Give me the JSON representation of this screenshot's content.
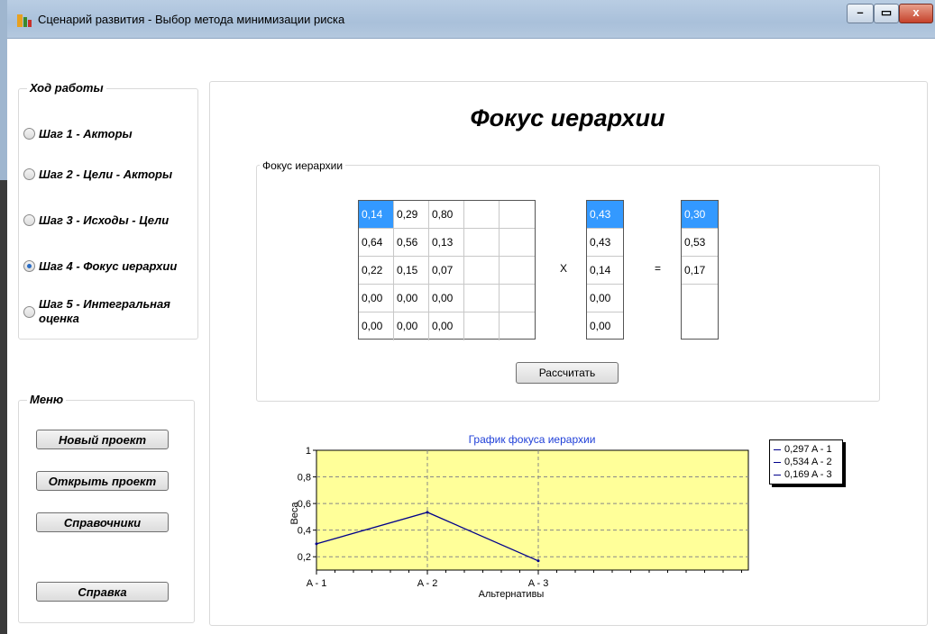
{
  "window": {
    "title": "Сценарий развития - Выбор метода минимизации риска",
    "controls": {
      "minimize": "–",
      "maximize": "▭",
      "close": "x"
    }
  },
  "workflow": {
    "title": "Ход работы",
    "steps": [
      {
        "label": "Шаг 1 - Акторы",
        "checked": false
      },
      {
        "label": "Шаг 2 - Цели - Акторы",
        "checked": false
      },
      {
        "label": "Шаг 3 - Исходы - Цели",
        "checked": false
      },
      {
        "label": "Шаг 4 - Фокус иерархии",
        "checked": true
      },
      {
        "label": "Шаг 5 - Интегральная",
        "label2": "оценка",
        "checked": false
      }
    ]
  },
  "menu": {
    "title": "Меню",
    "buttons": [
      "Новый проект",
      "Открыть проект",
      "Справочники",
      "Справка"
    ]
  },
  "main": {
    "heading": "Фокус иерархии",
    "group_label": "Фокус иерархии",
    "matrix": [
      [
        "0,14",
        "0,29",
        "0,80",
        "",
        ""
      ],
      [
        "0,64",
        "0,56",
        "0,13",
        "",
        ""
      ],
      [
        "0,22",
        "0,15",
        "0,07",
        "",
        ""
      ],
      [
        "0,00",
        "0,00",
        "0,00",
        "",
        ""
      ],
      [
        "0,00",
        "0,00",
        "0,00",
        "",
        ""
      ]
    ],
    "vector": [
      "0,43",
      "0,43",
      "0,14",
      "0,00",
      "0,00"
    ],
    "result": [
      "0,30",
      "0,53",
      "0,17",
      ""
    ],
    "multiply_sign": "X",
    "equals_sign": "=",
    "calc_button": "Рассчитать"
  },
  "chart_data": {
    "type": "line",
    "title": "График фокуса иерархии",
    "xlabel": "Альтернативы",
    "ylabel": "Веса",
    "categories": [
      "A - 1",
      "A - 2",
      "A - 3"
    ],
    "series": [
      {
        "name": "",
        "values": [
          0.297,
          0.534,
          0.169
        ]
      }
    ],
    "legend": [
      "0,297 A - 1",
      "0,534 A - 2",
      "0,169 A - 3"
    ],
    "yticks": [
      "1",
      "0,8",
      "0,6",
      "0,4",
      "0,2"
    ],
    "ylim": [
      0.1,
      1
    ],
    "grid": true,
    "legend_position": "right",
    "colors": {
      "plot_bg": "#ffff99",
      "line": "#00008b",
      "title": "#1f3fd8"
    }
  }
}
